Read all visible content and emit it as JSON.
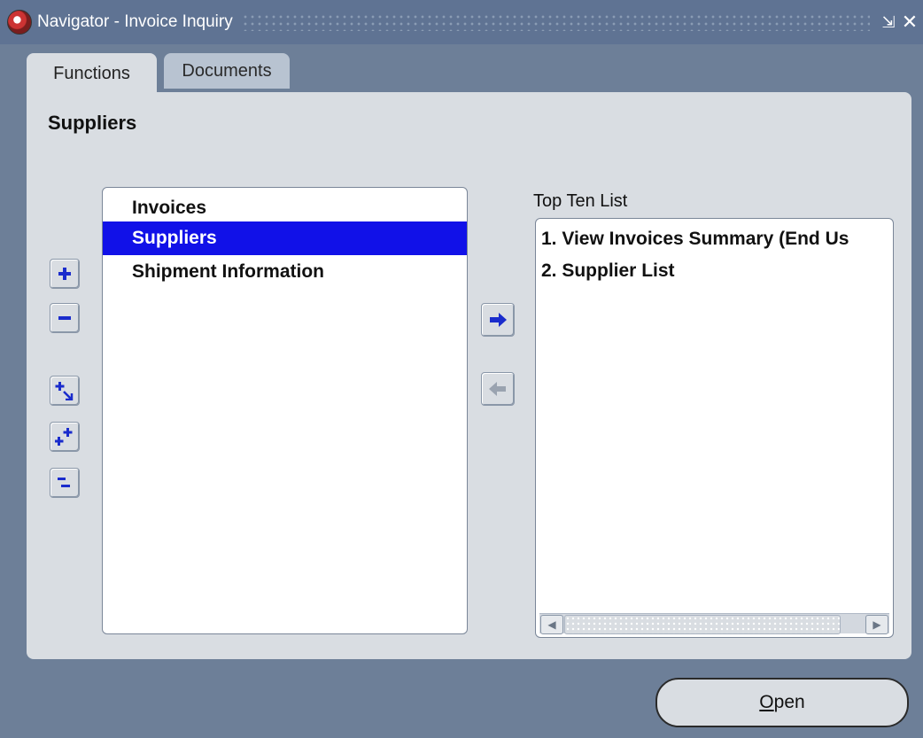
{
  "window": {
    "title": "Navigator - Invoice Inquiry",
    "icon": "oracle-app-icon",
    "minimize_glyph": "⇲",
    "close_glyph": "✕"
  },
  "tabs": [
    {
      "label": "Functions",
      "active": true
    },
    {
      "label": "Documents",
      "active": false
    }
  ],
  "panel": {
    "heading": "Suppliers"
  },
  "side_buttons": [
    {
      "name": "expand-one",
      "icon": "plus-icon"
    },
    {
      "name": "collapse-one",
      "icon": "minus-icon"
    },
    {
      "name": "expand-branch",
      "icon": "expand-branch-icon"
    },
    {
      "name": "expand-all",
      "icon": "expand-all-icon"
    },
    {
      "name": "collapse-all",
      "icon": "collapse-all-icon"
    }
  ],
  "function_list": {
    "items": [
      {
        "label": "Invoices",
        "selected": false
      },
      {
        "label": "Suppliers",
        "selected": true
      },
      {
        "label": "Shipment Information",
        "selected": false
      }
    ]
  },
  "transfer": {
    "add_icon": "arrow-right-icon",
    "remove_icon": "arrow-left-icon"
  },
  "top_ten": {
    "label": "Top Ten List",
    "items": [
      {
        "label": "1. View Invoices Summary (End Us"
      },
      {
        "label": "2. Supplier List"
      }
    ]
  },
  "open_button": {
    "mnemonic": "O",
    "rest": "pen"
  },
  "colors": {
    "background": "#6d7f98",
    "panel": "#d9dde2",
    "selection": "#1111e8",
    "arrow_active": "#1a2ccc",
    "arrow_disabled": "#9aa3b0"
  }
}
